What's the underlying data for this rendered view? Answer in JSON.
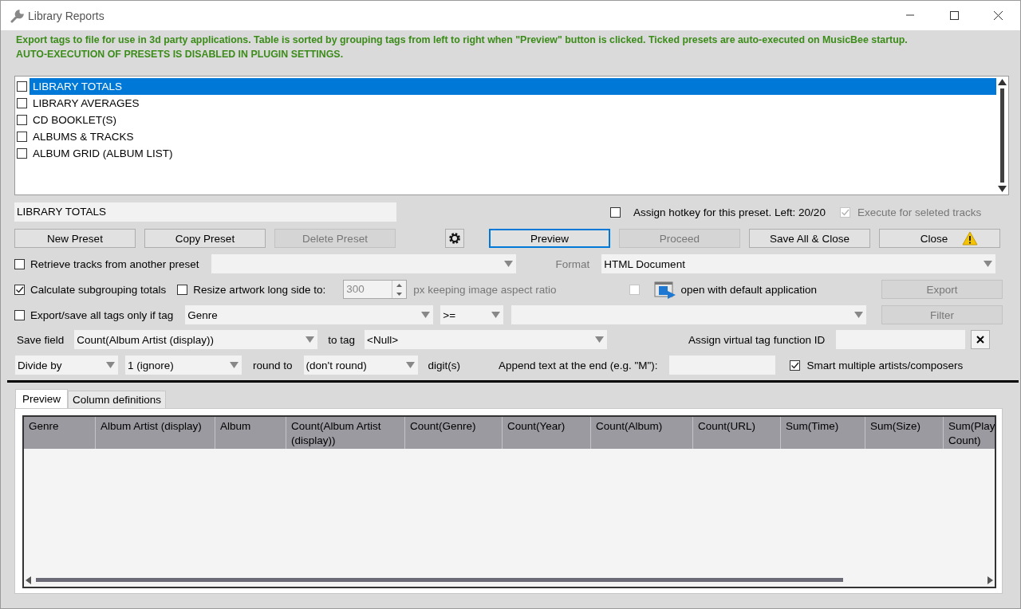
{
  "window": {
    "title": "Library Reports"
  },
  "intro": {
    "text": "Export tags to file for use in 3d party applications. Table is sorted by grouping tags from left to right when \"Preview\" button is clicked. Ticked presets are auto-executed on MusicBee startup.",
    "warning": "AUTO-EXECUTION OF PRESETS IS DISABLED IN PLUGIN SETTINGS."
  },
  "presets": [
    {
      "label": "LIBRARY TOTALS",
      "checked": false,
      "selected": true
    },
    {
      "label": "LIBRARY AVERAGES",
      "checked": false,
      "selected": false
    },
    {
      "label": "CD BOOKLET(S)",
      "checked": false,
      "selected": false
    },
    {
      "label": "ALBUMS & TRACKS",
      "checked": false,
      "selected": false
    },
    {
      "label": "ALBUM GRID (ALBUM LIST)",
      "checked": false,
      "selected": false
    }
  ],
  "preset_name": {
    "value": "LIBRARY TOTALS"
  },
  "hotkey": {
    "label": "Assign hotkey for this preset. Left: 20/20",
    "checked": false
  },
  "execute_selected": {
    "label": "Execute for seleted tracks",
    "checked": true,
    "disabled": true
  },
  "buttons": [
    {
      "kind": "text",
      "label": "New Preset",
      "disabled": false,
      "focused": false
    },
    {
      "kind": "text",
      "label": "Copy Preset",
      "disabled": false,
      "focused": false
    },
    {
      "kind": "text",
      "label": "Delete Preset",
      "disabled": true,
      "focused": false
    },
    {
      "kind": "settings",
      "disabled": false,
      "focused": false
    },
    {
      "kind": "text",
      "label": "Preview",
      "disabled": false,
      "focused": true
    },
    {
      "kind": "text",
      "label": "Proceed",
      "disabled": true,
      "focused": false
    },
    {
      "kind": "text",
      "label": "Save All & Close",
      "disabled": false,
      "focused": false
    },
    {
      "kind": "warning",
      "label": "Close",
      "disabled": false,
      "focused": false
    }
  ],
  "retrieve": {
    "label": "Retrieve tracks from another preset",
    "checked": false
  },
  "format": {
    "label": "Format",
    "value": "HTML Document"
  },
  "subgrouping": {
    "label": "Calculate subgrouping totals",
    "checked": true
  },
  "resize": {
    "label": "Resize artwork long side to:",
    "checked": false,
    "size": "300",
    "suffix": "px keeping image aspect ratio",
    "disabled": true
  },
  "open_default": {
    "label": "open with default application",
    "checked": false,
    "disabled": true
  },
  "export_button": {
    "label": "Export",
    "disabled": true
  },
  "filter": {
    "label": "Export/save all tags only if tag",
    "checked": false,
    "tag": "Genre",
    "operator": ">=",
    "button": {
      "label": "Filter",
      "disabled": true
    }
  },
  "save_field": {
    "label": "Save field",
    "field": "Count(Album Artist (display))",
    "to_label": "to tag",
    "to_tag": "<Null>",
    "virtual_tag_label": "Assign virtual tag function ID"
  },
  "divide": {
    "operation": "Divide by",
    "divisor": "1 (ignore)",
    "round_label": "round to",
    "round": "(don't round)",
    "digits_label": "digit(s)",
    "append_label": "Append text at the end (e.g. \"M\"):"
  },
  "smart_artists": {
    "label": "Smart multiple artists/composers",
    "checked": true
  },
  "tabs": [
    {
      "label": "Preview",
      "selected": true
    },
    {
      "label": "Column definitions",
      "selected": false
    }
  ],
  "table": {
    "columns": [
      "Genre",
      "Album Artist (display)",
      "Album",
      "Count(Album Artist (display))",
      "Count(Genre)",
      "Count(Year)",
      "Count(Album)",
      "Count(URL)",
      "Sum(Time)",
      "Sum(Size)",
      "Sum(Play Count)"
    ]
  }
}
